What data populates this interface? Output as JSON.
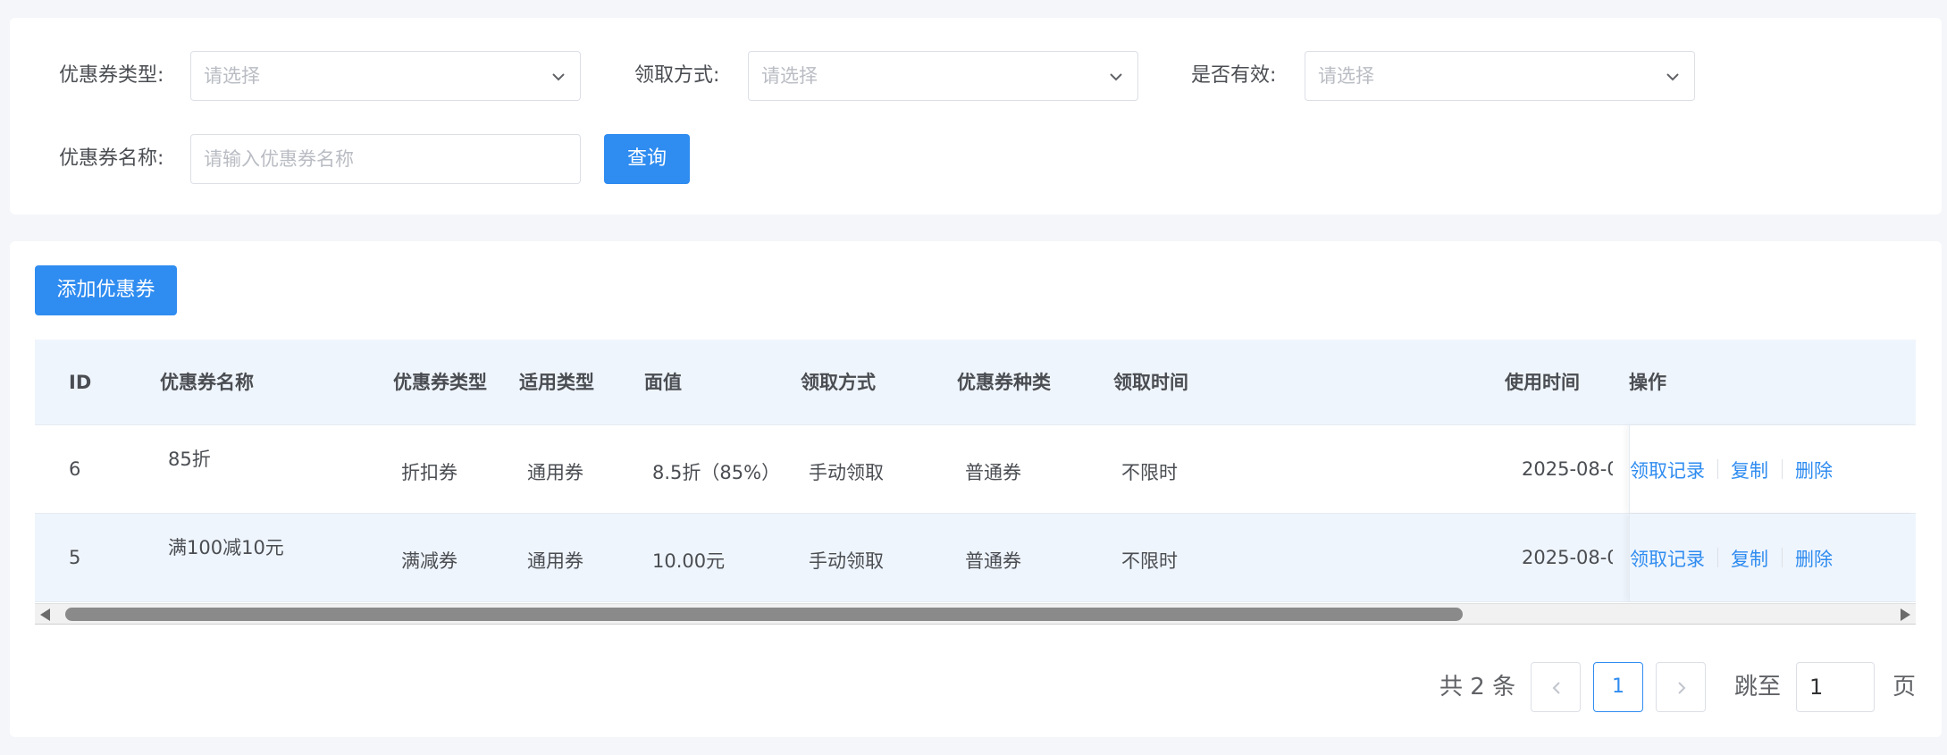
{
  "filters": {
    "coupon_type": {
      "label": "优惠券类型:",
      "placeholder": "请选择"
    },
    "claim_method": {
      "label": "领取方式:",
      "placeholder": "请选择"
    },
    "is_valid": {
      "label": "是否有效:",
      "placeholder": "请选择"
    },
    "coupon_name": {
      "label": "优惠券名称:",
      "placeholder": "请输入优惠券名称"
    },
    "query_button": "查询"
  },
  "toolbar": {
    "add_button": "添加优惠券"
  },
  "table": {
    "headers": {
      "id": "ID",
      "name": "优惠券名称",
      "type": "优惠券类型",
      "scope": "适用类型",
      "value": "面值",
      "method": "领取方式",
      "kind": "优惠券种类",
      "claim_time": "领取时间",
      "use_time": "使用时间",
      "ops": "操作"
    },
    "rows": [
      {
        "id": "6",
        "name": "85折",
        "type": "折扣券",
        "scope": "通用券",
        "value": "8.5折（85%）",
        "method": "手动领取",
        "kind": "普通券",
        "claim_time": "不限时",
        "use_time": "2025-08-0",
        "ops": {
          "records": "领取记录",
          "copy": "复制",
          "delete": "删除"
        }
      },
      {
        "id": "5",
        "name": "满100减10元",
        "type": "满减券",
        "scope": "通用券",
        "value": "10.00元",
        "method": "手动领取",
        "kind": "普通券",
        "claim_time": "不限时",
        "use_time": "2025-08-0",
        "ops": {
          "records": "领取记录",
          "copy": "复制",
          "delete": "删除"
        }
      }
    ]
  },
  "scrollbar": {
    "position": 0
  },
  "pagination": {
    "total": "共 2 条",
    "current_page": "1",
    "jump_label": "跳至",
    "jump_value": "1",
    "page_suffix": "页"
  },
  "colors": {
    "primary": "#2f8cf0",
    "header_bg": "#eff5fc",
    "page_bg": "#f4f6f9"
  },
  "icons": {
    "select_arrow": "chevron-down-icon",
    "prev": "chevron-left-icon",
    "next": "chevron-right-icon"
  }
}
